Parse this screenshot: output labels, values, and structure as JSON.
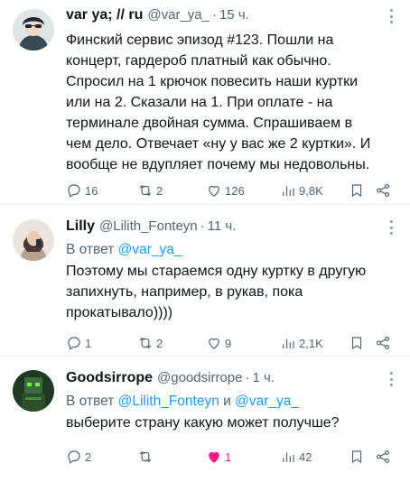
{
  "tweets": [
    {
      "name": "var ya; // ru",
      "handle": "@var_ya_",
      "sep": "·",
      "time": "15 ч.",
      "lines": [
        "Финский сервис эпизод #123. Пошли на",
        "концерт, гардероб  платный как обычно.",
        "Спросил на 1 крючок повесить наши куртки",
        "или на 2. Сказали на 1. При оплате - на",
        "терминале двойная сумма. Спрашиваем в",
        "чем дело. Отвечает «ну у вас же 2 куртки». И",
        "вообще не вдупляет почему мы недовольны."
      ],
      "stats": {
        "replies": "16",
        "retweets": "2",
        "likes": "126",
        "views": "9,8K"
      }
    },
    {
      "name": "Lilly",
      "handle": "@Lilith_Fonteyn",
      "sep": "·",
      "time": "11 ч.",
      "reply_prefix": "В ответ",
      "reply_to": "@var_ya_",
      "lines": [
        "Поэтому мы стараемся одну куртку в другую",
        "запихнуть, например, в рукав, пока",
        "прокатывало))))"
      ],
      "stats": {
        "replies": "1",
        "retweets": "2",
        "likes": "9",
        "views": "2,1K"
      }
    },
    {
      "name": "Goodsirrope",
      "handle": "@goodsirrope",
      "sep": "·",
      "time": "1 ч.",
      "reply_prefix": "В ответ",
      "reply_to": "@Lilith_Fonteyn",
      "reply_and": "и",
      "reply_to_2": "@var_ya_",
      "lines": [
        "выберите страну какую может получше?"
      ],
      "stats": {
        "replies": "2",
        "retweets": "",
        "likes": "1",
        "views": "42"
      }
    }
  ],
  "colors": {
    "link": "#1d9bf0",
    "secondary": "#536471",
    "like_active": "#f91880"
  }
}
